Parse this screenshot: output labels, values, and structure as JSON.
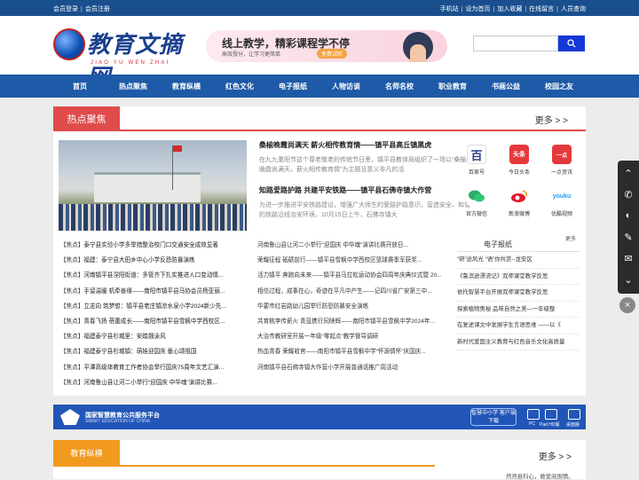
{
  "topbar": {
    "left": [
      "会员登录",
      "会员注册"
    ],
    "right": [
      "手机站",
      "设为首页",
      "加入收藏",
      "在线留言",
      "人员查询"
    ]
  },
  "logo": {
    "title": "教育文摘网",
    "subtitle": "JIAO YU WEN ZHAI"
  },
  "banner": {
    "title": "线上教学，精彩课程学不停",
    "subtitle": "高效授分，让学习更简单",
    "button": "免费试听"
  },
  "search": {
    "placeholder": "",
    "icon": "search-icon"
  },
  "nav": [
    "首页",
    "热点聚焦",
    "教育纵横",
    "红色文化",
    "电子报纸",
    "人物访谈",
    "名师名校",
    "职业教育",
    "书画公益",
    "校园之友"
  ],
  "hot": {
    "tag": "热点聚焦",
    "more": "更多 > >",
    "featured": [
      {
        "title": "桑榆晚霞尚满天 薪火相传教育情——镇平县高丘镇黑虎",
        "summary": "在九九重阳节这个尊老敬老的传统节日里，镇平县教体局组织了一场以“桑榆晚霞尚满天，薪火相传教育情”为主题且意义非凡的活"
      },
      {
        "title": "知路爱路护路 共建平安铁路——镇平县石佛寺镇大作营",
        "summary": "为进一步推进平安铁路建设，增强广大师生的爱路护路意识，营造安全、和谐的铁路沿线治安环境，10月15日上午，石佛寺镇大"
      }
    ],
    "apps": [
      {
        "label": "百家号",
        "icon": "baijiahao-icon",
        "color": "#ffffff"
      },
      {
        "label": "今日头条",
        "icon": "toutiao-icon",
        "color": "#e4393c"
      },
      {
        "label": "一点资讯",
        "icon": "yidian-icon",
        "color": "#e4393c"
      },
      {
        "label": "官方微信",
        "icon": "wechat-icon",
        "color": "#2aae67"
      },
      {
        "label": "新浪微博",
        "icon": "weibo-icon",
        "color": "#e6162d"
      },
      {
        "label": "优酷视频",
        "icon": "youku-icon",
        "color": "#1f9ff2"
      }
    ],
    "list_left": [
      [
        "【焦点】",
        "泰宁县实验小学多举措整治校门口交通安全成效显著"
      ],
      [
        "【焦点】",
        "福建：泰宁县大田乡中心小学反恐防暴演练"
      ],
      [
        "【焦点】",
        "河南镇平县涅阳街道：多管齐下扎实推进人口变动情..."
      ],
      [
        "【焦点】",
        "手留温暖 机牵善缘——南阳市镇平县马协会员杨亚丽..."
      ],
      [
        "【焦点】",
        "立志向 筑梦想：镇平县老庄镇凉水泉小学2024新少先..."
      ],
      [
        "【焦点】",
        "青春飞扬 蓓蕾成长——南阳市镇平县雪枫中学西校区..."
      ],
      [
        "【焦点】",
        "福建泰宁县杉城里：安踏翘泳风"
      ],
      [
        "【焦点】",
        "福建泰宁县杉城镇：萌娃迎国庆 童心颂祖国"
      ],
      [
        "【焦点】",
        "平潭高级体教育工作者协会举行国庆75周年文艺汇演..."
      ],
      [
        "【焦点】",
        "河南鲁山县让河二小举行“迎国庆 中华魂”演讲比赛..."
      ]
    ],
    "list_right": [
      "河南鲁山县让河二小举行“迎国庆 中华魂”演讲比赛开放日...",
      "荣耀征程 砥砺前行——镇平县雪枫中学西校区篮球赛季军获奖...",
      "活力镇平 奔跑向未来——镇平县马拉松运动协会四周年庆典仪式暨 20...",
      "相信过程，成事在心，奇迹在平凡中产生——记四川省广安第三中...",
      "华要市红岩路幼儿园举行防恐防暴安全演练",
      "共育桃李传薪火 青蓝携行同映辉——南阳市镇平县雪枫中学2024年...",
      "大治市教研室开展一年级“零起点”教学督导调研",
      "热血青春 荣耀收官——南阳市镇平县雪枫中学“怀源情怀”庆国庆...",
      "河南镇平县石佛寺镇大作营小学开展普通话推广周活动"
    ],
    "epaper_title": "电子报纸",
    "epaper_more": "更多",
    "epaper": [
      "“研”途风光 “语”你共赏--龙安区",
      "《鲁滨逊漂流记》双师课堂教学反思",
      "依托智慧平台开展双师课堂教学反思",
      "探索植物奥秘 品味自然之美—一年级整",
      "在复述课文中发展学生言语思维 ——以《",
      "新时代爱国主义教育与红色音乐文化高质量"
    ]
  },
  "adbar": {
    "title": "国家智慧教育公共服务平台",
    "subtitle": "SMART EDUCATION OF CHINA",
    "pill": "智慧中小学 客户端下载",
    "devices": [
      "PC",
      "Pad HD版",
      "桌面版"
    ]
  },
  "edu": {
    "tag": "教育纵横",
    "more": "更多 > >",
    "snippet": "然然县科心，敢爱阅围情。"
  }
}
